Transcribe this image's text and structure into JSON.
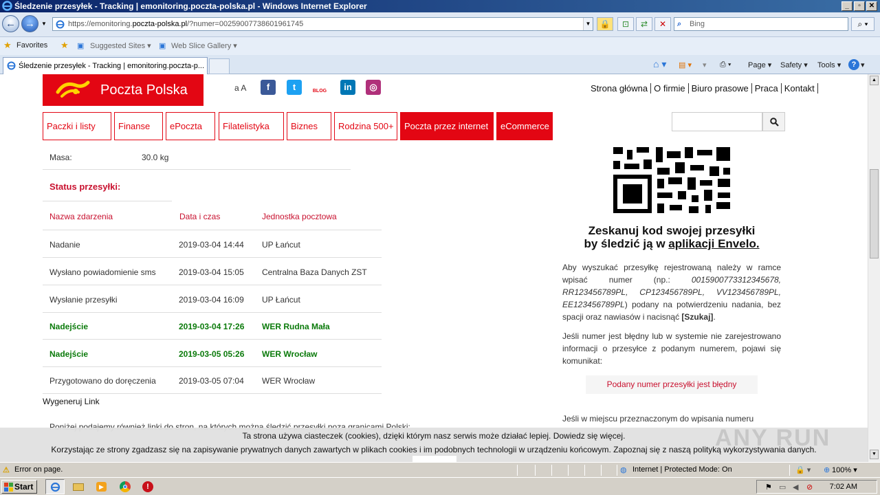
{
  "window": {
    "title": "Śledzenie przesyłek - Tracking | emonitoring.poczta-polska.pl - Windows Internet Explorer",
    "min": "_",
    "max": "▫",
    "close": "✕"
  },
  "browser": {
    "url_prefix": "https://emonitoring.",
    "url_domain": "poczta-polska.pl",
    "url_rest": "/?numer=00259007738601961745",
    "search_placeholder": "Bing",
    "favorites": "Favorites",
    "suggested_sites": "Suggested Sites ▾",
    "web_slice": "Web Slice Gallery ▾",
    "tab_title": "Śledzenie przesyłek - Tracking | emonitoring.poczta-p...",
    "cmd_page": "Page ▾",
    "cmd_safety": "Safety ▾",
    "cmd_tools": "Tools ▾",
    "cmd_help": "?"
  },
  "site": {
    "logo_text": "Poczta Polska",
    "font_size_toggle": "a A",
    "social": [
      {
        "name": "facebook",
        "label": "f",
        "color": "#3b5998"
      },
      {
        "name": "twitter",
        "label": "t",
        "color": "#1da1f2"
      },
      {
        "name": "blog",
        "label": "BLOG",
        "color": "#e30613"
      },
      {
        "name": "linkedin",
        "label": "in",
        "color": "#0077b5"
      },
      {
        "name": "instagram",
        "label": "◎",
        "color": "#b0307a"
      }
    ],
    "top_links": [
      "Strona główna",
      "O firmie",
      "Biuro prasowe",
      "Praca",
      "Kontakt"
    ],
    "menu": [
      "Paczki i listy",
      "Finanse",
      "ePoczta",
      "Filatelistyka",
      "Biznes",
      "Rodzina 500+",
      "Poczta przez internet",
      "eCommerce"
    ]
  },
  "shipment": {
    "mass_label": "Masa:",
    "mass_value": "30.0 kg",
    "status_heading": "Status przesyłki:",
    "columns": [
      "Nazwa zdarzenia",
      "Data i czas",
      "Jednostka pocztowa"
    ],
    "events": [
      {
        "name": "Nadanie",
        "date": "2019-03-04 14:44",
        "unit": "UP Łańcut",
        "highlight": false
      },
      {
        "name": "Wysłano powiadomienie sms",
        "date": "2019-03-04 15:05",
        "unit": "Centralna Baza Danych ZST",
        "highlight": false
      },
      {
        "name": "Wysłanie przesyłki",
        "date": "2019-03-04 16:09",
        "unit": "UP Łańcut",
        "highlight": false
      },
      {
        "name": "Nadejście",
        "date": "2019-03-04 17:26",
        "unit": "WER Rudna Mała",
        "highlight": true
      },
      {
        "name": "Nadejście",
        "date": "2019-03-05 05:26",
        "unit": "WER Wrocław",
        "highlight": true
      },
      {
        "name": "Przygotowano do doręczenia",
        "date": "2019-03-05 07:04",
        "unit": "WER Wrocław",
        "highlight": false
      }
    ],
    "generate_link": "Wygeneruj Link",
    "below_text": "Poniżej podajemy również linki do stron, na których można śledzić przesyłki poza granicami Polski:"
  },
  "sidebar": {
    "qr_title_line1": "Zeskanuj kod swojej przesyłki",
    "qr_title_line2_prefix": "by śledzić ją w ",
    "qr_title_link": "aplikacji Envelo.",
    "para1_a": "Aby wyszukać przesyłkę rejestrowaną należy w ramce wpisać numer (np.: ",
    "para1_examples": "00159007733123456​78, RR123456789PL, CP123456789PL, VV123456789PL, EE123456789PL",
    "para1_b": ") podany na potwierdzeniu nadania, bez spacji oraz nawiasów i nacisnąć ",
    "para1_btn": "[Szukaj]",
    "para1_end": ".",
    "para2": "Jeśli numer jest błędny lub w systemie nie zarejestrowano informacji o przesyłce z podanym numerem, pojawi się komunikat:",
    "error_msg": "Podany numer przesyłki jest błędny",
    "para3": "Jeśli w miejscu przeznaczonym do wpisania numeru"
  },
  "cookie": {
    "line1_a": "Ta strona używa ciasteczek (cookies), dzięki którym nasz serwis może działać lepiej. ",
    "line1_link": "Dowiedz się więcej.",
    "line2_a": "Korzystając ze strony zgadzasz się na zapisywanie prywatnych danych zawartych w plikach cookies i im podobnych technologii w urządzeniu końcowym. ",
    "line2_link": "Zapoznaj się z naszą polityką wykorzystywania danych."
  },
  "watermark": "ANY RUN",
  "status": {
    "error": "Error on page.",
    "zone": "Internet | Protected Mode: On",
    "zoom": "100% ▾"
  },
  "taskbar": {
    "start": "Start",
    "clock": "7:02 AM"
  }
}
